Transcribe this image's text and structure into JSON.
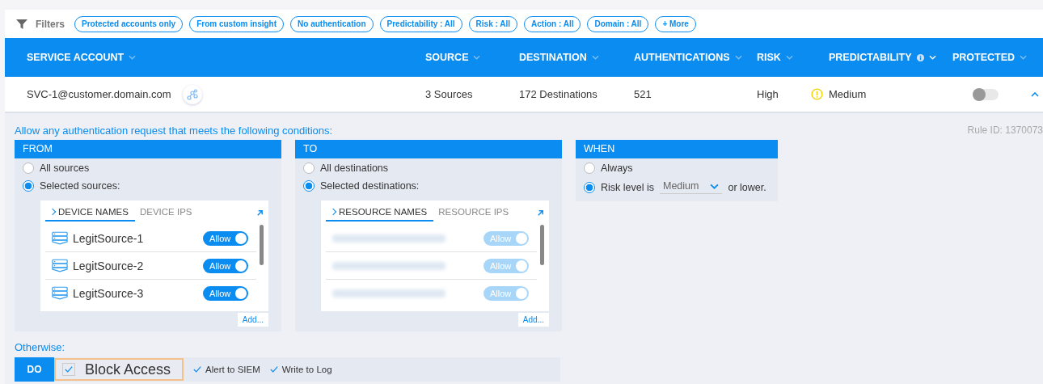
{
  "filters": {
    "label": "Filters",
    "chips": [
      "Protected accounts only",
      "From custom insight",
      "No authentication",
      "Predictability : All",
      "Risk : All",
      "Action : All",
      "Domain : All",
      "+ More"
    ]
  },
  "table": {
    "columns": [
      {
        "label": "SERVICE ACCOUNT"
      },
      {
        "label": "SOURCE"
      },
      {
        "label": "DESTINATION"
      },
      {
        "label": "AUTHENTICATIONS"
      },
      {
        "label": "RISK"
      },
      {
        "label": "PREDICTABILITY",
        "info": true
      },
      {
        "label": "PROTECTED"
      }
    ],
    "row": {
      "account": "SVC-1@customer.domain.com",
      "sources": "3 Sources",
      "destinations": "172 Destinations",
      "authentications": "521",
      "risk": "High",
      "risk_warning": true,
      "predictability": "Medium",
      "protected": false,
      "expanded": true
    }
  },
  "rule": {
    "intro": "Allow any authentication request that meets the following conditions:",
    "rule_id": "Rule ID: 1370073",
    "from": {
      "title": "FROM",
      "options": [
        {
          "label": "All sources",
          "selected": false
        },
        {
          "label": "Selected sources:",
          "selected": true
        }
      ],
      "tabs": [
        {
          "label": "DEVICE NAMES",
          "selected": true
        },
        {
          "label": "DEVICE IPS",
          "selected": false
        }
      ],
      "items": [
        {
          "name": "LegitSource-1",
          "toggle": "Allow",
          "on": true
        },
        {
          "name": "LegitSource-2",
          "toggle": "Allow",
          "on": true
        },
        {
          "name": "LegitSource-3",
          "toggle": "Allow",
          "on": true
        }
      ],
      "add": "Add..."
    },
    "to": {
      "title": "TO",
      "options": [
        {
          "label": "All destinations",
          "selected": false
        },
        {
          "label": "Selected destinations:",
          "selected": true
        }
      ],
      "tabs": [
        {
          "label": "RESOURCE NAMES",
          "selected": true
        },
        {
          "label": "RESOURCE IPS",
          "selected": false
        }
      ],
      "items": [
        {
          "toggle": "Allow",
          "on": true,
          "blurred": true
        },
        {
          "toggle": "Allow",
          "on": true,
          "blurred": true
        },
        {
          "toggle": "Allow",
          "on": true,
          "blurred": true
        }
      ],
      "add": "Add..."
    },
    "when": {
      "title": "WHEN",
      "options": [
        {
          "label": "Always",
          "selected": false,
          "kind": "plain"
        },
        {
          "label": "Risk level is",
          "selected": true,
          "kind": "risk",
          "dropdown": "Medium",
          "suffix": "or lower."
        }
      ]
    },
    "otherwise": {
      "label": "Otherwise:",
      "do": "DO",
      "actions": [
        {
          "label": "Block Access",
          "checked": true,
          "highlighted": true
        },
        {
          "label": "Alert to SIEM",
          "checked": true,
          "highlighted": false
        },
        {
          "label": "Write to Log",
          "checked": true,
          "highlighted": false
        }
      ]
    }
  }
}
